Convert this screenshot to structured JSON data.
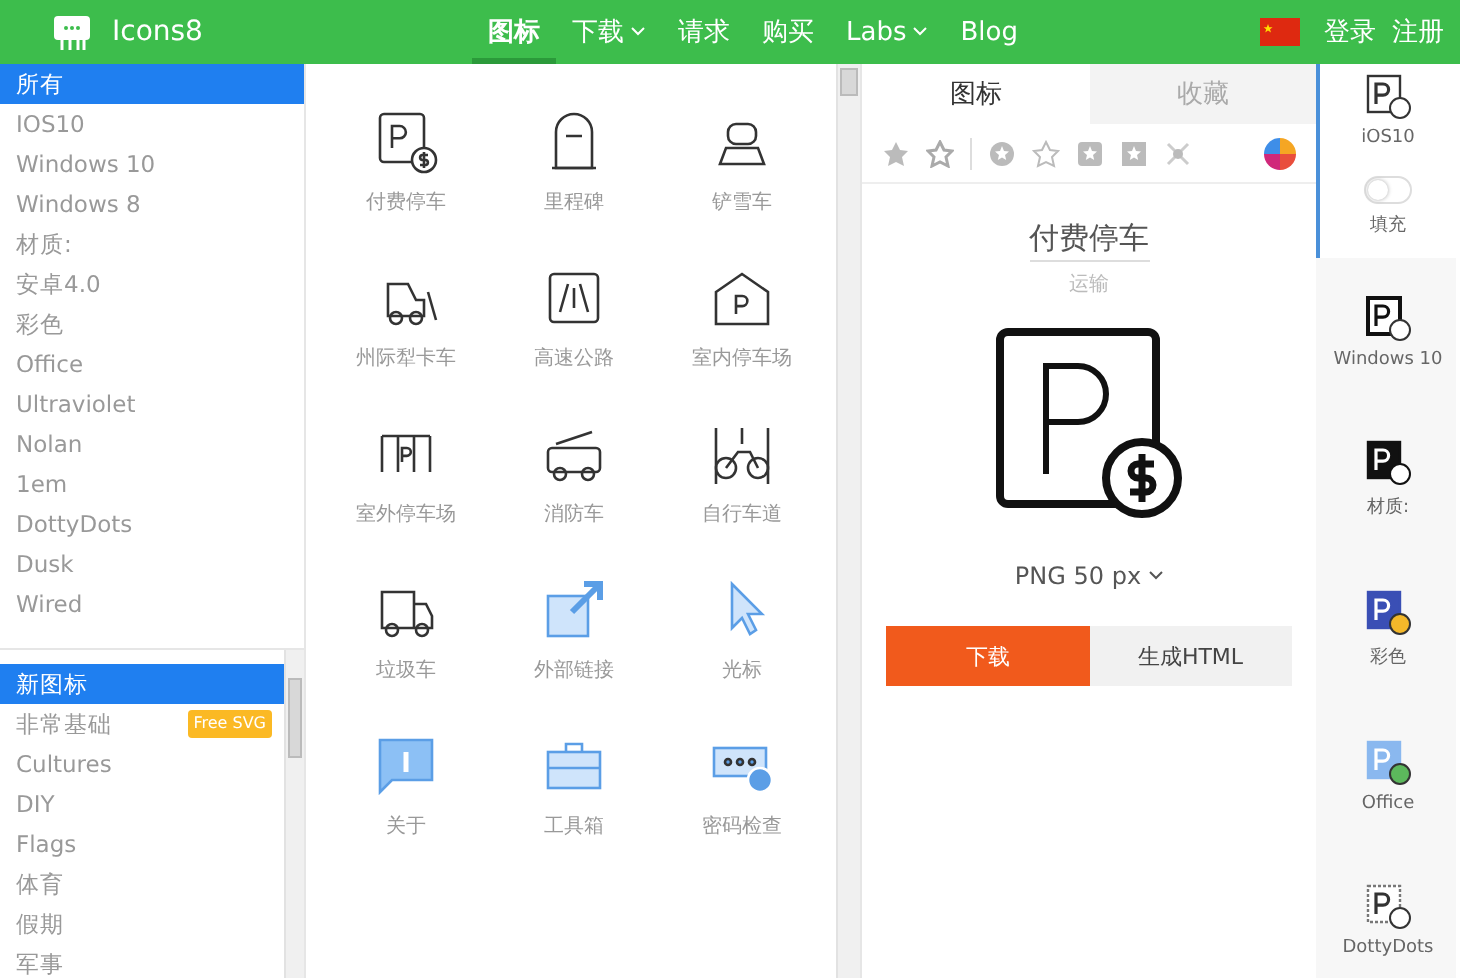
{
  "header": {
    "logo_text": "Icons8",
    "nav": [
      {
        "label": "图标",
        "selected": true,
        "dropdown": false
      },
      {
        "label": "下载",
        "selected": false,
        "dropdown": true
      },
      {
        "label": "请求",
        "selected": false,
        "dropdown": false
      },
      {
        "label": "购买",
        "selected": false,
        "dropdown": false
      },
      {
        "label": "Labs",
        "selected": false,
        "dropdown": true
      },
      {
        "label": "Blog",
        "selected": false,
        "dropdown": false
      }
    ],
    "login": "登录",
    "register": "注册"
  },
  "sidebar": {
    "styles": [
      {
        "label": "所有",
        "selected": true
      },
      {
        "label": "IOS10",
        "selected": false
      },
      {
        "label": "Windows 10",
        "selected": false
      },
      {
        "label": "Windows 8",
        "selected": false
      },
      {
        "label": "材质:",
        "selected": false
      },
      {
        "label": "安卓4.0",
        "selected": false
      },
      {
        "label": "彩色",
        "selected": false
      },
      {
        "label": "Office",
        "selected": false
      },
      {
        "label": "Ultraviolet",
        "selected": false
      },
      {
        "label": "Nolan",
        "selected": false
      },
      {
        "label": "1em",
        "selected": false
      },
      {
        "label": "DottyDots",
        "selected": false
      },
      {
        "label": "Dusk",
        "selected": false
      },
      {
        "label": "Wired",
        "selected": false
      }
    ],
    "categories": [
      {
        "label": "新图标",
        "selected": true
      },
      {
        "label": "非常基础",
        "selected": false,
        "badge": "Free SVG"
      },
      {
        "label": "Cultures",
        "selected": false
      },
      {
        "label": "DIY",
        "selected": false
      },
      {
        "label": "Flags",
        "selected": false
      },
      {
        "label": "体育",
        "selected": false
      },
      {
        "label": "假期",
        "selected": false
      },
      {
        "label": "军事",
        "selected": false
      }
    ]
  },
  "grid": {
    "icons": [
      {
        "label": "付费停车"
      },
      {
        "label": "里程碑"
      },
      {
        "label": "铲雪车"
      },
      {
        "label": "州际犁卡车"
      },
      {
        "label": "高速公路"
      },
      {
        "label": "室内停车场"
      },
      {
        "label": "室外停车场"
      },
      {
        "label": "消防车"
      },
      {
        "label": "自行车道"
      },
      {
        "label": "垃圾车"
      },
      {
        "label": "外部链接"
      },
      {
        "label": "光标"
      },
      {
        "label": "关于"
      },
      {
        "label": "工具箱"
      },
      {
        "label": "密码检查"
      }
    ]
  },
  "detail": {
    "tabs": [
      {
        "label": "图标",
        "selected": true
      },
      {
        "label": "收藏",
        "selected": false
      }
    ],
    "title": "付费停车",
    "category": "运输",
    "size": "PNG 50 px",
    "download": "下载",
    "html": "生成HTML"
  },
  "styles_column": {
    "items": [
      {
        "label": "iOS10",
        "selected": true,
        "kind": "outline"
      },
      {
        "label": "Windows 10",
        "selected": false,
        "kind": "bold"
      },
      {
        "label": "材质:",
        "selected": false,
        "kind": "solid"
      },
      {
        "label": "彩色",
        "selected": false,
        "kind": "color"
      },
      {
        "label": "Office",
        "selected": false,
        "kind": "office"
      },
      {
        "label": "DottyDots",
        "selected": false,
        "kind": "dotted"
      }
    ],
    "fill_toggle": {
      "label": "填充",
      "on": false
    }
  }
}
